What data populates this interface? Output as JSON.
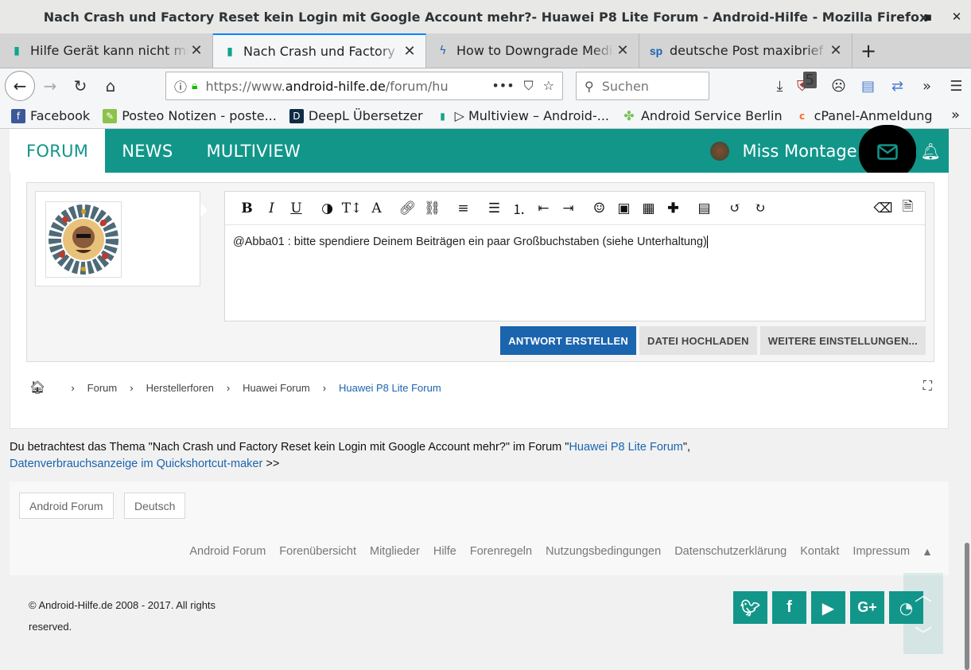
{
  "window": {
    "title": "Nach Crash und Factory Reset kein Login mit Google Account mehr?- Huawei P8 Lite Forum - Android-Hilfe - Mozilla Firefox",
    "controls": [
      "–",
      "▪",
      "✕"
    ]
  },
  "tabs": [
    {
      "label": "Hilfe Gerät kann nicht mehr",
      "active": false
    },
    {
      "label": "Nach Crash und Factory Re",
      "active": true
    },
    {
      "label": "How to Downgrade Media",
      "active": false
    },
    {
      "label": "deutsche Post maxibrief -",
      "active": false
    }
  ],
  "nav": {
    "url_prefix": "https://www.",
    "url_domain": "android-hilfe.de",
    "url_path": "/forum/hu",
    "search_placeholder": "Suchen",
    "badge_count": "5"
  },
  "bookmarks": [
    {
      "label": "Facebook",
      "color": "#3b5998",
      "icon": "f"
    },
    {
      "label": "Posteo Notizen - poste...",
      "color": "#8bc34a",
      "icon": "✎"
    },
    {
      "label": "DeepL Übersetzer",
      "color": "#0f2b46",
      "icon": "D"
    },
    {
      "label": "▷ Multiview – Android-...",
      "color": "#11a48a",
      "icon": "▮"
    },
    {
      "label": "Android Service Berlin",
      "color": "#78c257",
      "icon": "✤"
    },
    {
      "label": "cPanel-Anmeldung",
      "color": "#ff6c2c",
      "icon": "c"
    }
  ],
  "forum_nav": {
    "items": [
      "FORUM",
      "NEWS",
      "MULTIVIEW"
    ],
    "username": "Miss Montage"
  },
  "editor": {
    "text": "@Abba01 : bitte spendiere Deinem Beiträgen ein paar Großbuchstaben (siehe Unterhaltung)",
    "buttons": {
      "reply": "ANTWORT ERSTELLEN",
      "upload": "DATEI HOCHLADEN",
      "more": "WEITERE EINSTELLUNGEN..."
    }
  },
  "breadcrumb": [
    "Forum",
    "Herstellerforen",
    "Huawei Forum",
    "Huawei P8 Lite Forum"
  ],
  "viewing": {
    "prefix": "Du betrachtest das Thema \"Nach Crash und Factory Reset kein Login mit Google Account mehr?\" im Forum \"",
    "forum_link": "Huawei P8 Lite Forum",
    "suffix": "\",",
    "next_link": "Datenverbrauchsanzeige im Quickshortcut-maker",
    "next_suffix": " >>"
  },
  "footer": {
    "style_button": "Android Forum",
    "language_button": "Deutsch",
    "links": [
      "Android Forum",
      "Forenübersicht",
      "Mitglieder",
      "Hilfe",
      "Forenregeln",
      "Nutzungsbedingungen",
      "Datenschutzerklärung",
      "Kontakt",
      "Impressum"
    ],
    "copyright": "© Android-Hilfe.de 2008 - 2017. All rights reserved.",
    "social": [
      "twitter-icon",
      "facebook-icon",
      "youtube-icon",
      "googleplus-icon",
      "rss-icon"
    ]
  },
  "colors": {
    "brand_teal": "#12968a",
    "link_blue": "#1b64ae",
    "primary_button": "#1b64ae"
  }
}
